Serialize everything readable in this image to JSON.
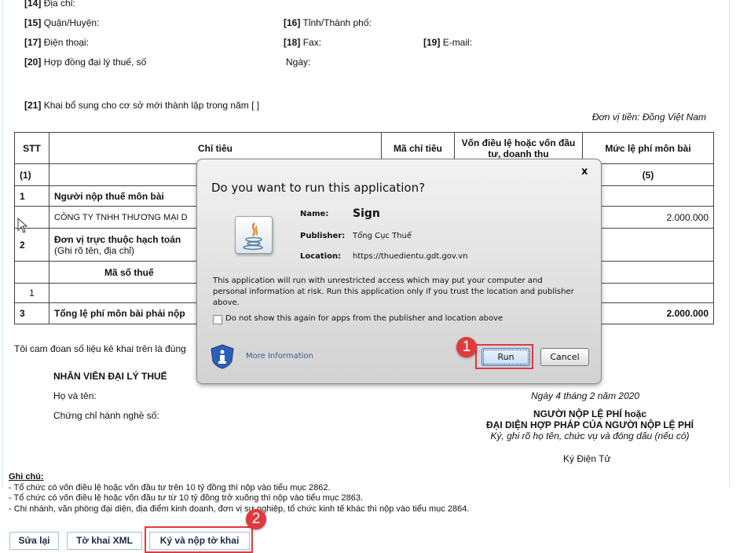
{
  "form": {
    "f14": {
      "num": "[14]",
      "label": "Địa chỉ:"
    },
    "f15": {
      "num": "[15]",
      "label": "Quận/Huyện:"
    },
    "f16": {
      "num": "[16]",
      "label": "Tỉnh/Thành phố:"
    },
    "f17": {
      "num": "[17]",
      "label": "Điện thoại:"
    },
    "f18": {
      "num": "[18]",
      "label": "Fax:"
    },
    "f19": {
      "num": "[19]",
      "label": "E-mail:"
    },
    "f20": {
      "num": "[20]",
      "label": "Hợp đồng đại lý thuế, số"
    },
    "f20_date": "Ngày:",
    "f21": {
      "num": "[21]",
      "label": "Khai bổ sung cho cơ sở mới thành lập trong năm  [  ]"
    },
    "currency_unit": "Đơn vị tiền: Đồng Việt Nam"
  },
  "table": {
    "headers": [
      "STT",
      "Chỉ tiêu",
      "Mã chỉ tiêu",
      "Vốn điều lệ hoặc vốn đầu tư, doanh thu",
      "Mức lệ phí môn bài"
    ],
    "index_row": [
      "(1)",
      "",
      "",
      "",
      "(5)"
    ],
    "rows": [
      {
        "stt": "1",
        "label": "Người nộp thuế môn bài",
        "value": ""
      },
      {
        "stt": "",
        "label": "CÔNG TY TNHH THƯƠNG MẠI D",
        "value": "2.000.000"
      },
      {
        "stt": "2",
        "label": "Đơn vị trực thuộc hạch toán",
        "sub": "(Ghi rõ tên, địa chỉ)",
        "value": ""
      },
      {
        "stt": "",
        "label": "Mã số thuế",
        "value": ""
      },
      {
        "stt": "1",
        "label": "",
        "value": ""
      },
      {
        "stt": "3",
        "label": "Tổng lệ phí môn bài phải nộp",
        "value": "2.000.000"
      }
    ]
  },
  "declaration": "Tôi cam đoan số liệu kê khai trên là đúng",
  "agent": {
    "title": "NHÂN VIÊN ĐẠI LÝ THUẾ",
    "name_label": "Họ và tên:",
    "cert_label": "Chứng chỉ hành nghề số:"
  },
  "signer": {
    "date": "Ngày 4 tháng 2 năm 2020",
    "line1": "NGƯỜI NỘP LỆ PHÍ hoặc",
    "line2": "ĐẠI DIỆN HỢP PHÁP CỦA NGƯỜI NỘP LỆ PHÍ",
    "note": "Ký, ghi rõ họ tên, chức vụ và đóng dấu (nếu có)",
    "sign": "Ký Điện Tử"
  },
  "notes": {
    "title": "Ghi chú:",
    "items": [
      "- Tổ chức có vốn điều lệ hoặc vốn đầu tư trên 10 tỷ đồng thì nộp vào tiểu mục 2862.",
      "- Tổ chức có vốn điều lệ hoặc vốn đầu tư từ 10 tỷ đồng trở xuống thì nộp vào tiểu mục 2863.",
      "- Chi nhánh, văn phòng đại diện, địa điểm kinh doanh, đơn vị sự nghiệp, tổ chức kinh tế khác thì nộp vào tiểu mục 2864."
    ]
  },
  "footer": {
    "edit": "Sửa lại",
    "xml": "Tờ khai XML",
    "submit": "Ký và nộp tờ khai"
  },
  "dialog": {
    "title": "Do you want to run this application?",
    "close": "x",
    "name_label": "Name:",
    "name": "Sign",
    "publisher_label": "Publisher:",
    "publisher": "Tổng Cục Thuế",
    "location_label": "Location:",
    "location": "https://thuedientu.gdt.gov.vn",
    "warning": "This application will run with unrestricted access which may put your computer and personal information at risk. Run this application only if you trust the location and publisher above.",
    "checkbox_label": "Do not show this again for apps from the publisher and location above",
    "checkbox_checked": false,
    "more_info": "More Information",
    "run": "Run",
    "cancel": "Cancel"
  },
  "annotations": {
    "step1": "1",
    "step2": "2",
    "color": "#e0393e"
  }
}
